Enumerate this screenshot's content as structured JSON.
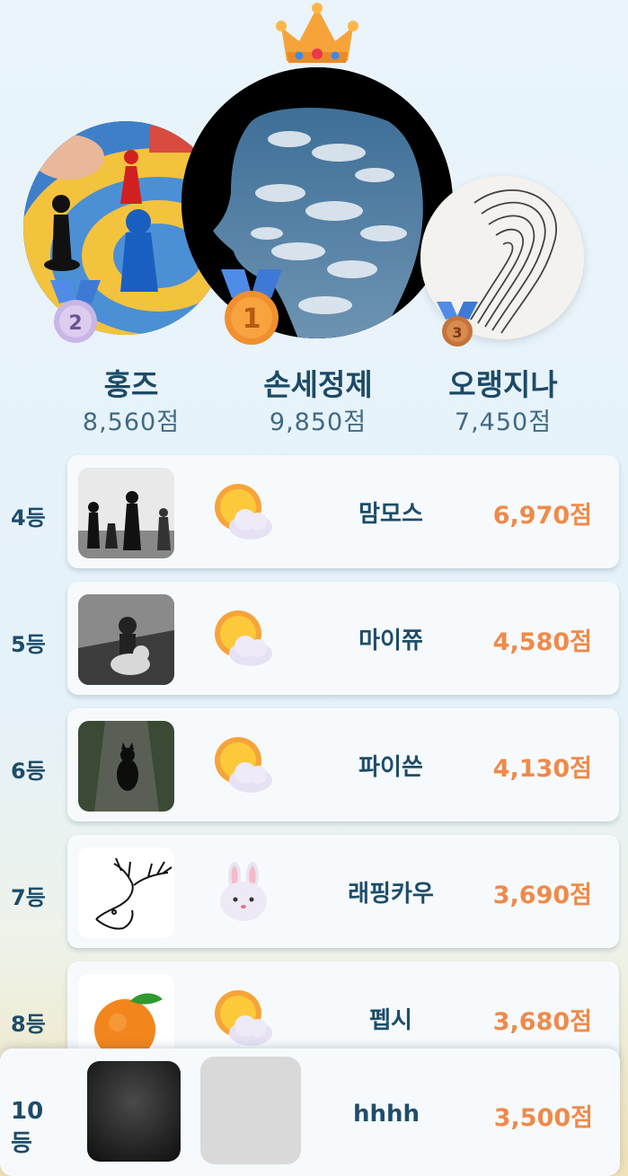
{
  "podium": {
    "first": {
      "name": "손세정제",
      "score": "9,850점",
      "medal": "1"
    },
    "second": {
      "name": "홍즈",
      "score": "8,560점",
      "medal": "2"
    },
    "third": {
      "name": "오랭지나",
      "score": "7,450점",
      "medal": "3"
    }
  },
  "rows": [
    {
      "rank": "4등",
      "name": "맘모스",
      "score": "6,970점",
      "thumb": "chess-pieces-photo",
      "emoji": "sun-behind-cloud-icon"
    },
    {
      "rank": "5등",
      "name": "마이쮸",
      "score": "4,580점",
      "thumb": "bear-doll-photo",
      "emoji": "sun-behind-cloud-icon"
    },
    {
      "rank": "6등",
      "name": "파이쓴",
      "score": "4,130점",
      "thumb": "black-cat-photo",
      "emoji": "sun-behind-cloud-icon"
    },
    {
      "rank": "7등",
      "name": "래핑카우",
      "score": "3,690점",
      "thumb": "deer-sketch",
      "emoji": "rabbit-face-icon"
    },
    {
      "rank": "8등",
      "name": "펩시",
      "score": "3,680점",
      "thumb": "orange-photo",
      "emoji": "sun-behind-cloud-icon"
    }
  ],
  "me": {
    "rank": "10등",
    "name": "hhhh",
    "score": "3,500점"
  },
  "colors": {
    "score": "#ef8a4a",
    "name": "#1d4d6a",
    "bg": "#e9f4fb"
  }
}
